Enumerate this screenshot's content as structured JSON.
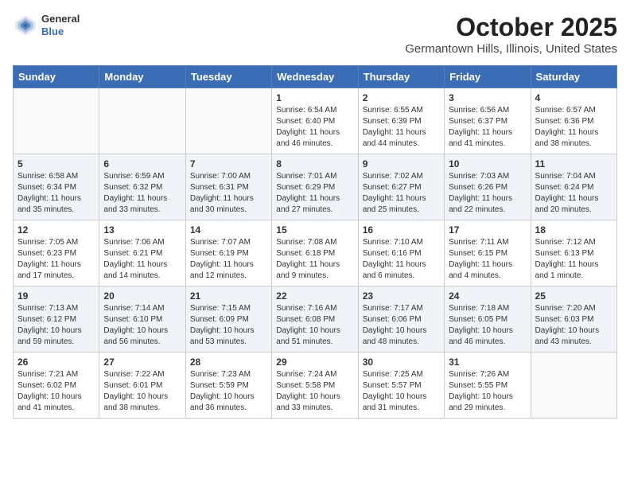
{
  "header": {
    "logo_general": "General",
    "logo_blue": "Blue",
    "month_title": "October 2025",
    "location": "Germantown Hills, Illinois, United States"
  },
  "days_of_week": [
    "Sunday",
    "Monday",
    "Tuesday",
    "Wednesday",
    "Thursday",
    "Friday",
    "Saturday"
  ],
  "weeks": [
    [
      {
        "day": "",
        "info": ""
      },
      {
        "day": "",
        "info": ""
      },
      {
        "day": "",
        "info": ""
      },
      {
        "day": "1",
        "info": "Sunrise: 6:54 AM\nSunset: 6:40 PM\nDaylight: 11 hours and 46 minutes."
      },
      {
        "day": "2",
        "info": "Sunrise: 6:55 AM\nSunset: 6:39 PM\nDaylight: 11 hours and 44 minutes."
      },
      {
        "day": "3",
        "info": "Sunrise: 6:56 AM\nSunset: 6:37 PM\nDaylight: 11 hours and 41 minutes."
      },
      {
        "day": "4",
        "info": "Sunrise: 6:57 AM\nSunset: 6:36 PM\nDaylight: 11 hours and 38 minutes."
      }
    ],
    [
      {
        "day": "5",
        "info": "Sunrise: 6:58 AM\nSunset: 6:34 PM\nDaylight: 11 hours and 35 minutes."
      },
      {
        "day": "6",
        "info": "Sunrise: 6:59 AM\nSunset: 6:32 PM\nDaylight: 11 hours and 33 minutes."
      },
      {
        "day": "7",
        "info": "Sunrise: 7:00 AM\nSunset: 6:31 PM\nDaylight: 11 hours and 30 minutes."
      },
      {
        "day": "8",
        "info": "Sunrise: 7:01 AM\nSunset: 6:29 PM\nDaylight: 11 hours and 27 minutes."
      },
      {
        "day": "9",
        "info": "Sunrise: 7:02 AM\nSunset: 6:27 PM\nDaylight: 11 hours and 25 minutes."
      },
      {
        "day": "10",
        "info": "Sunrise: 7:03 AM\nSunset: 6:26 PM\nDaylight: 11 hours and 22 minutes."
      },
      {
        "day": "11",
        "info": "Sunrise: 7:04 AM\nSunset: 6:24 PM\nDaylight: 11 hours and 20 minutes."
      }
    ],
    [
      {
        "day": "12",
        "info": "Sunrise: 7:05 AM\nSunset: 6:23 PM\nDaylight: 11 hours and 17 minutes."
      },
      {
        "day": "13",
        "info": "Sunrise: 7:06 AM\nSunset: 6:21 PM\nDaylight: 11 hours and 14 minutes."
      },
      {
        "day": "14",
        "info": "Sunrise: 7:07 AM\nSunset: 6:19 PM\nDaylight: 11 hours and 12 minutes."
      },
      {
        "day": "15",
        "info": "Sunrise: 7:08 AM\nSunset: 6:18 PM\nDaylight: 11 hours and 9 minutes."
      },
      {
        "day": "16",
        "info": "Sunrise: 7:10 AM\nSunset: 6:16 PM\nDaylight: 11 hours and 6 minutes."
      },
      {
        "day": "17",
        "info": "Sunrise: 7:11 AM\nSunset: 6:15 PM\nDaylight: 11 hours and 4 minutes."
      },
      {
        "day": "18",
        "info": "Sunrise: 7:12 AM\nSunset: 6:13 PM\nDaylight: 11 hours and 1 minute."
      }
    ],
    [
      {
        "day": "19",
        "info": "Sunrise: 7:13 AM\nSunset: 6:12 PM\nDaylight: 10 hours and 59 minutes."
      },
      {
        "day": "20",
        "info": "Sunrise: 7:14 AM\nSunset: 6:10 PM\nDaylight: 10 hours and 56 minutes."
      },
      {
        "day": "21",
        "info": "Sunrise: 7:15 AM\nSunset: 6:09 PM\nDaylight: 10 hours and 53 minutes."
      },
      {
        "day": "22",
        "info": "Sunrise: 7:16 AM\nSunset: 6:08 PM\nDaylight: 10 hours and 51 minutes."
      },
      {
        "day": "23",
        "info": "Sunrise: 7:17 AM\nSunset: 6:06 PM\nDaylight: 10 hours and 48 minutes."
      },
      {
        "day": "24",
        "info": "Sunrise: 7:18 AM\nSunset: 6:05 PM\nDaylight: 10 hours and 46 minutes."
      },
      {
        "day": "25",
        "info": "Sunrise: 7:20 AM\nSunset: 6:03 PM\nDaylight: 10 hours and 43 minutes."
      }
    ],
    [
      {
        "day": "26",
        "info": "Sunrise: 7:21 AM\nSunset: 6:02 PM\nDaylight: 10 hours and 41 minutes."
      },
      {
        "day": "27",
        "info": "Sunrise: 7:22 AM\nSunset: 6:01 PM\nDaylight: 10 hours and 38 minutes."
      },
      {
        "day": "28",
        "info": "Sunrise: 7:23 AM\nSunset: 5:59 PM\nDaylight: 10 hours and 36 minutes."
      },
      {
        "day": "29",
        "info": "Sunrise: 7:24 AM\nSunset: 5:58 PM\nDaylight: 10 hours and 33 minutes."
      },
      {
        "day": "30",
        "info": "Sunrise: 7:25 AM\nSunset: 5:57 PM\nDaylight: 10 hours and 31 minutes."
      },
      {
        "day": "31",
        "info": "Sunrise: 7:26 AM\nSunset: 5:55 PM\nDaylight: 10 hours and 29 minutes."
      },
      {
        "day": "",
        "info": ""
      }
    ]
  ]
}
